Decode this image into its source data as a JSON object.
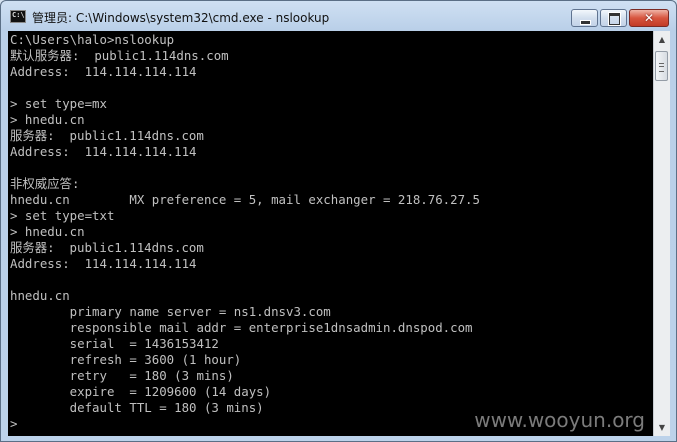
{
  "window": {
    "title": "管理员: C:\\Windows\\system32\\cmd.exe - nslookup",
    "close_glyph": "✕"
  },
  "console": {
    "lines": [
      "C:\\Users\\halo>nslookup",
      "默认服务器:  public1.114dns.com",
      "Address:  114.114.114.114",
      "",
      "> set type=mx",
      "> hnedu.cn",
      "服务器:  public1.114dns.com",
      "Address:  114.114.114.114",
      "",
      "非权威应答:",
      "hnedu.cn        MX preference = 5, mail exchanger = 218.76.27.5",
      "> set type=txt",
      "> hnedu.cn",
      "服务器:  public1.114dns.com",
      "Address:  114.114.114.114",
      "",
      "hnedu.cn",
      "        primary name server = ns1.dnsv3.com",
      "        responsible mail addr = enterprise1dnsadmin.dnspod.com",
      "        serial  = 1436153412",
      "        refresh = 3600 (1 hour)",
      "        retry   = 180 (3 mins)",
      "        expire  = 1209600 (14 days)",
      "        default TTL = 180 (3 mins)",
      ">"
    ],
    "watermark": "www.wooyun.org"
  }
}
